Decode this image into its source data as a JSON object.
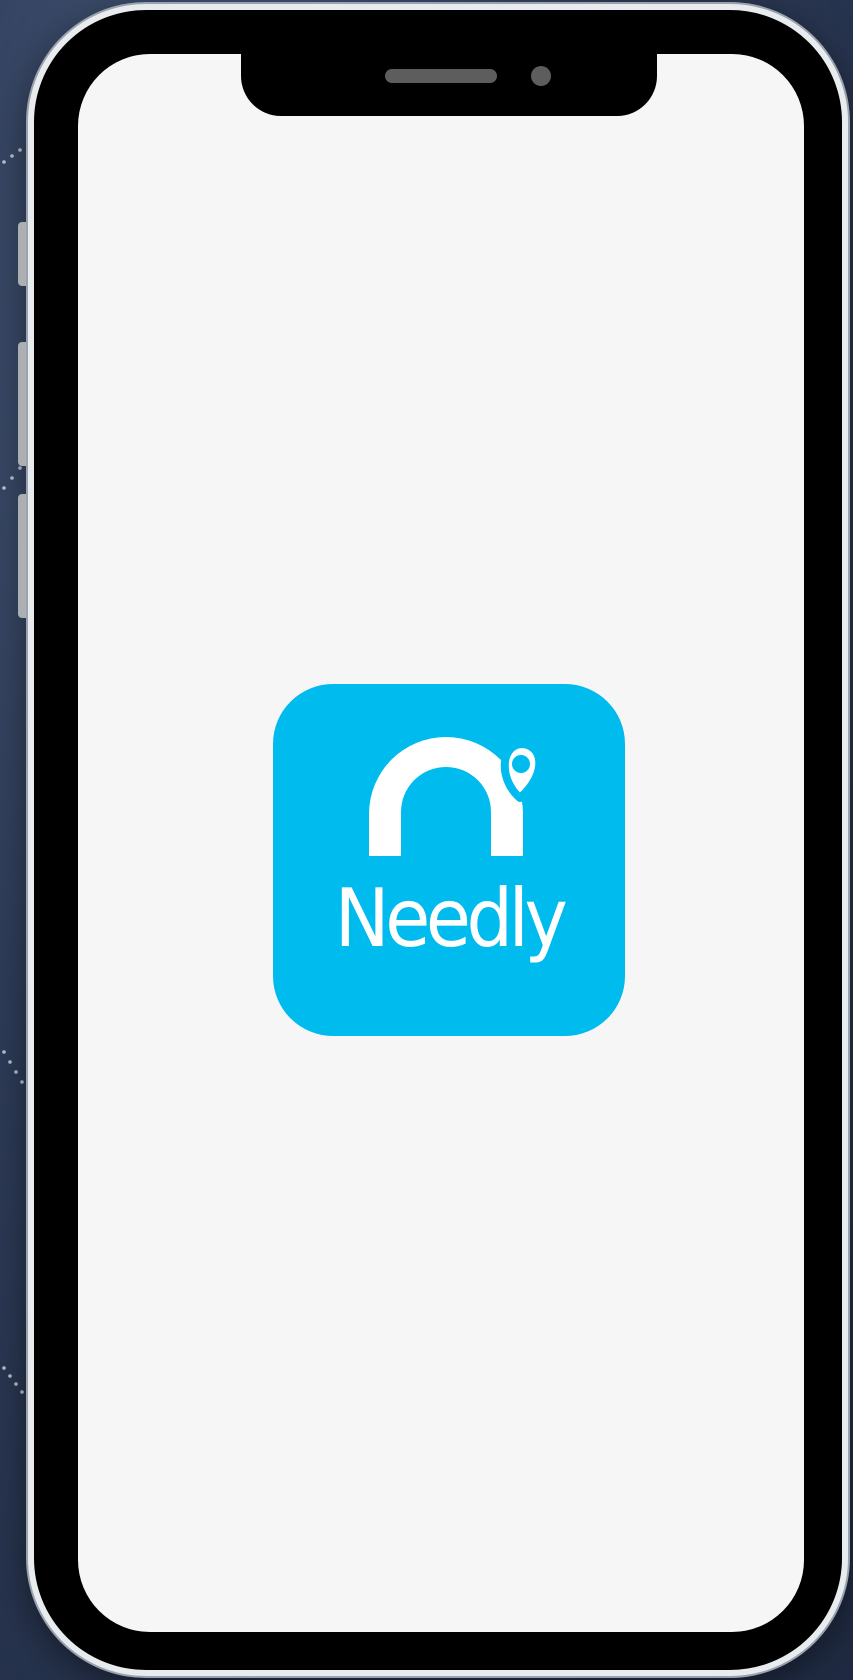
{
  "device": {
    "type": "phone",
    "frame_color": "#000000",
    "bezel_color": "#e9ecef"
  },
  "screen": {
    "background": "#f6f6f6",
    "view": "splash-screen"
  },
  "splash": {
    "logo": {
      "wordmark": "Needly",
      "background_color": "#00bbee",
      "foreground_color": "#ffffff",
      "icons": [
        "arch-icon",
        "location-pin-icon"
      ]
    }
  },
  "backdrop": {
    "color": "#2f3d5a"
  }
}
